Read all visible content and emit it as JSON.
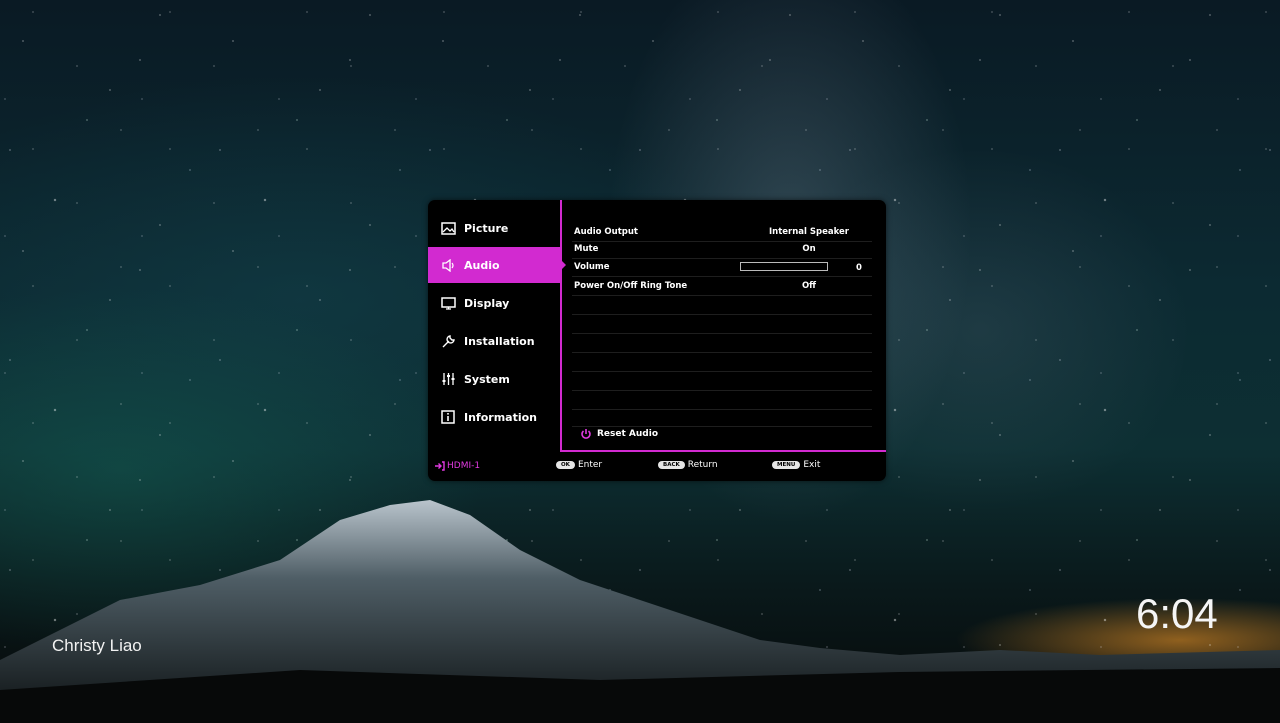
{
  "sidebar": {
    "items": [
      {
        "label": "Picture",
        "icon": "picture-icon",
        "active": false
      },
      {
        "label": "Audio",
        "icon": "speaker-icon",
        "active": true
      },
      {
        "label": "Display",
        "icon": "monitor-icon",
        "active": false
      },
      {
        "label": "Installation",
        "icon": "wrench-icon",
        "active": false
      },
      {
        "label": "System",
        "icon": "sliders-icon",
        "active": false
      },
      {
        "label": "Information",
        "icon": "info-icon",
        "active": false
      }
    ]
  },
  "audio": {
    "rows": [
      {
        "label": "Audio Output",
        "value": "Internal Speaker"
      },
      {
        "label": "Mute",
        "value": "On"
      },
      {
        "label": "Volume",
        "value": "0",
        "level": 0
      },
      {
        "label": "Power On/Off Ring Tone",
        "value": "Off"
      }
    ],
    "reset_label": "Reset Audio"
  },
  "footer": {
    "source": "HDMI-1",
    "ok_key": "OK",
    "ok_label": "Enter",
    "back_key": "BACK",
    "back_label": "Return",
    "menu_key": "MENU",
    "menu_label": "Exit"
  },
  "screen": {
    "user_name": "Christy Liao",
    "clock": "6:04"
  },
  "colors": {
    "accent": "#d22ad0"
  }
}
